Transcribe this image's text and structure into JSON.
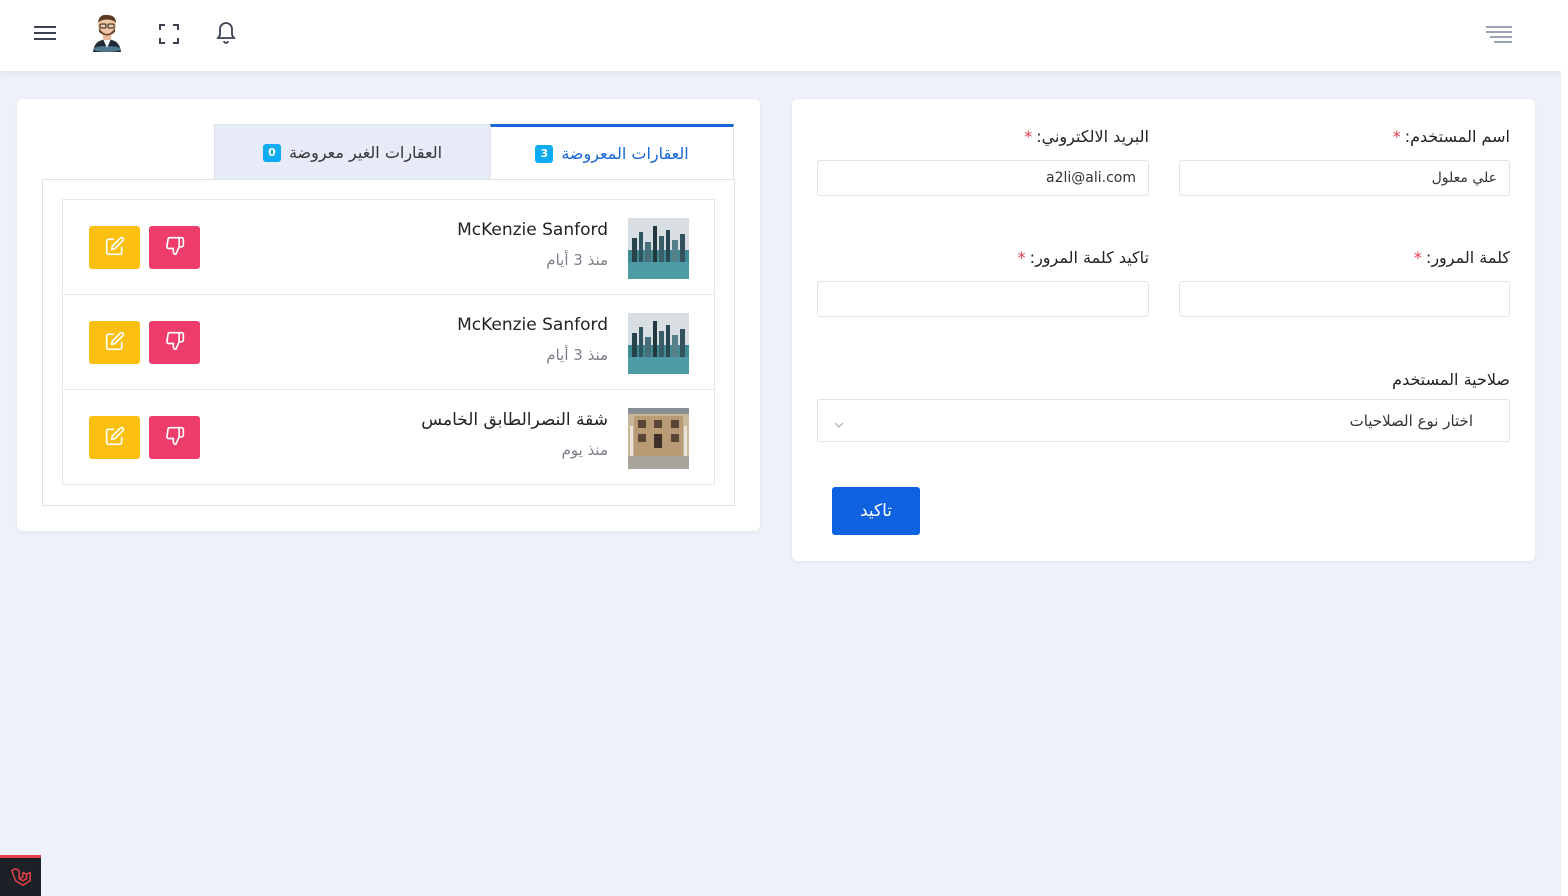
{
  "header": {
    "icons": [
      "menu-icon",
      "avatar",
      "fullscreen-icon",
      "bell-icon",
      "align-right-icon"
    ]
  },
  "tabs": [
    {
      "label": "العقارات المعروضة",
      "count": "3",
      "active": true
    },
    {
      "label": "العقارات الغير معروضة",
      "count": "0",
      "active": false
    }
  ],
  "properties": [
    {
      "title": "McKenzie Sanford",
      "time": "منذ 3 أيام",
      "image": "city-skyline"
    },
    {
      "title": "McKenzie Sanford",
      "time": "منذ 3 أيام",
      "image": "city-skyline"
    },
    {
      "title": "شقة النصرالطابق الخامس",
      "time": "منذ يوم",
      "image": "building-facade"
    }
  ],
  "form": {
    "username_label": "اسم المستخدم:",
    "username_value": "علي معلول",
    "email_label": "البريد الالكتروني:",
    "email_value": "a2li@ali.com",
    "password_label": "كلمة المرور:",
    "password_value": "",
    "confirm_label": "تاكيد كلمة المرور:",
    "confirm_value": "",
    "required_mark": "*",
    "role_label": "صلاحية المستخدم",
    "role_placeholder": "اختار نوع الصلاحيات",
    "submit_label": "تاكيد"
  },
  "colors": {
    "primary": "#0e62df",
    "warning": "#fbbf10",
    "danger": "#ee3d6a",
    "info_badge": "#0dabf2",
    "background": "#eef1f9"
  }
}
